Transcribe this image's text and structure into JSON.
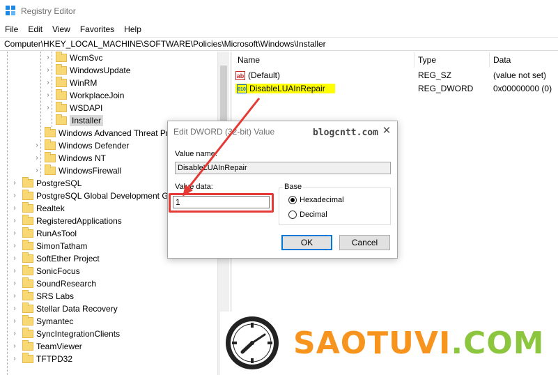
{
  "window": {
    "title": "Registry Editor"
  },
  "menu": [
    "File",
    "Edit",
    "View",
    "Favorites",
    "Help"
  ],
  "address": "Computer\\HKEY_LOCAL_MACHINE\\SOFTWARE\\Policies\\Microsoft\\Windows\\Installer",
  "tree": {
    "level3": [
      {
        "label": "WcmSvc",
        "expandable": true
      },
      {
        "label": "WindowsUpdate",
        "expandable": true
      },
      {
        "label": "WinRM",
        "expandable": true
      },
      {
        "label": "WorkplaceJoin",
        "expandable": true
      },
      {
        "label": "WSDAPI",
        "expandable": true
      },
      {
        "label": "Installer",
        "expandable": false,
        "selected": true
      }
    ],
    "level2": [
      {
        "label": "Windows Advanced Threat Pro",
        "expandable": false
      },
      {
        "label": "Windows Defender",
        "expandable": true
      },
      {
        "label": "Windows NT",
        "expandable": true
      },
      {
        "label": "WindowsFirewall",
        "expandable": true
      }
    ],
    "level0": [
      "PostgreSQL",
      "PostgreSQL Global Development Gro",
      "Realtek",
      "RegisteredApplications",
      "RunAsTool",
      "SimonTatham",
      "SoftEther Project",
      "SonicFocus",
      "SoundResearch",
      "SRS Labs",
      "Stellar Data Recovery",
      "Symantec",
      "SyncIntegrationClients",
      "TeamViewer",
      "TFTPD32"
    ]
  },
  "values": {
    "headers": {
      "name": "Name",
      "type": "Type",
      "data": "Data"
    },
    "rows": [
      {
        "icon": "string-value-icon",
        "icon_text": "ab",
        "name": "(Default)",
        "type": "REG_SZ",
        "data": "(value not set)"
      },
      {
        "icon": "dword-value-icon",
        "icon_text": "010",
        "name": "DisableLUAInRepair",
        "type": "REG_DWORD",
        "data": "0x00000000 (0)"
      }
    ]
  },
  "dialog": {
    "title": "Edit DWORD (32-bit) Value",
    "watermark": "blogcntt.com",
    "close_glyph": "✕",
    "value_name_label": "Value name:",
    "value_name": "DisableLUAInRepair",
    "value_data_label": "Value data:",
    "value_data": "1",
    "base_label": "Base",
    "base_options": [
      {
        "label": "Hexadecimal",
        "checked": true
      },
      {
        "label": "Decimal",
        "checked": false
      }
    ],
    "ok_label": "OK",
    "cancel_label": "Cancel"
  },
  "logo": {
    "text_orange": "SAOTUVI",
    "text_green": ".COM"
  },
  "colors": {
    "highlight": "#ffff00",
    "annotation_red": "#e53935",
    "logo_orange": "#f7941d",
    "logo_green": "#8cc63f",
    "folder": "#f8d775"
  }
}
